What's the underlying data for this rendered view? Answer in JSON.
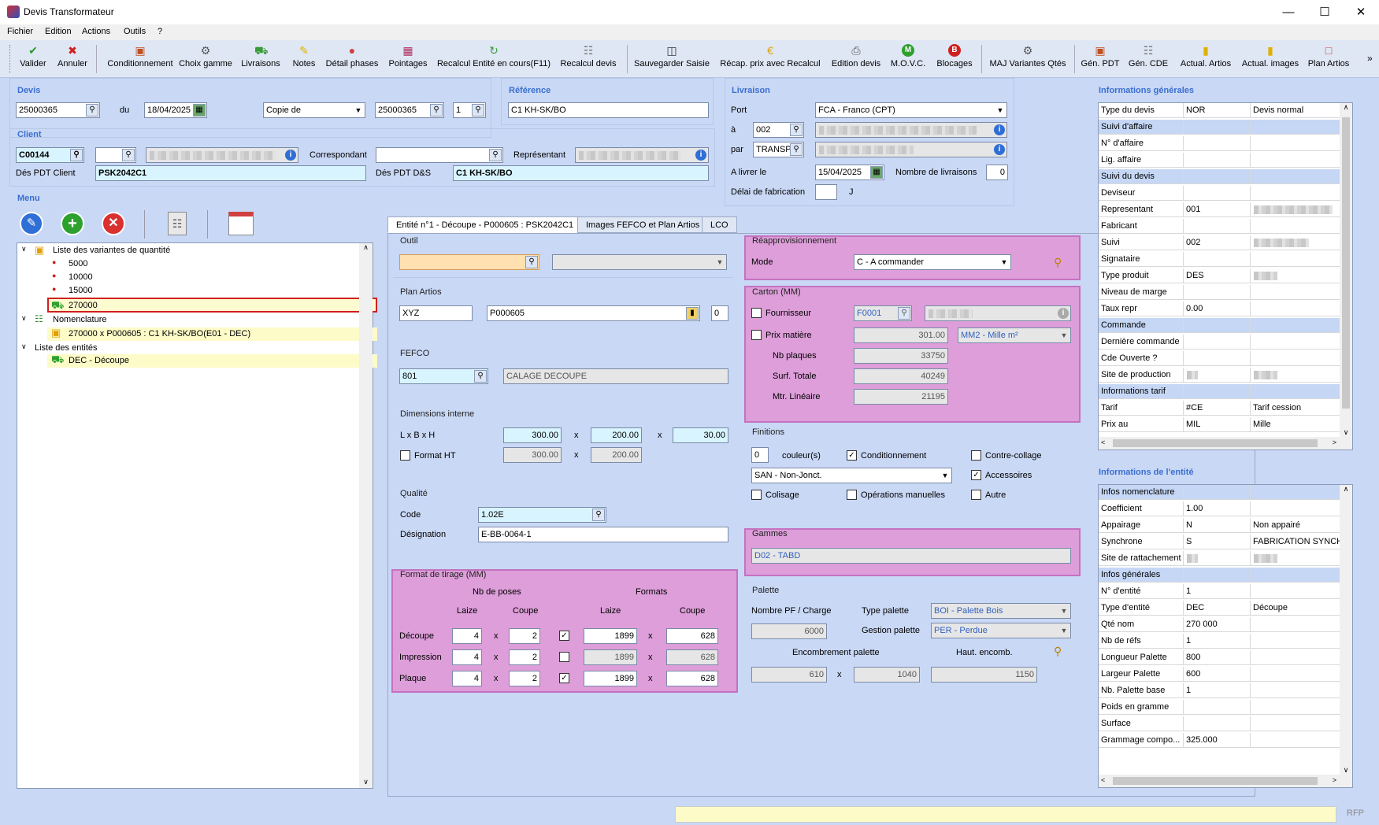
{
  "title": "Devis Transformateur",
  "menu": [
    "Fichier",
    "Edition",
    "Actions",
    "Outils",
    "?"
  ],
  "toolbar": [
    {
      "label": "Valider",
      "icon": "check-icon",
      "color": "#2e9a2e"
    },
    {
      "label": "Annuler",
      "icon": "close-icon",
      "color": "#d02020"
    },
    {
      "label": "Conditionnement",
      "icon": "package-icon",
      "color": "#c05020"
    },
    {
      "label": "Choix gamme",
      "icon": "gears-icon",
      "color": "#555"
    },
    {
      "label": "Livraisons",
      "icon": "truck-icon",
      "color": "#3a9a3a"
    },
    {
      "label": "Notes",
      "icon": "note-icon",
      "color": "#e0b000"
    },
    {
      "label": "Détail phases",
      "icon": "phases-icon",
      "color": "#d04040"
    },
    {
      "label": "Pointages",
      "icon": "grid-icon",
      "color": "#b03060"
    },
    {
      "label": "Recalcul Entité en cours(F11)",
      "icon": "recalc-icon",
      "color": "#3a9a3a"
    },
    {
      "label": "Recalcul devis",
      "icon": "calculator-icon",
      "color": "#777"
    },
    {
      "label": "Sauvegarder Saisie",
      "icon": "save-icon",
      "color": "#333"
    },
    {
      "label": "Récap. prix avec Recalcul",
      "icon": "euro-icon",
      "color": "#e0a000"
    },
    {
      "label": "Edition devis",
      "icon": "printer-icon",
      "color": "#555"
    },
    {
      "label": "M.O.V.C.",
      "icon": "m-icon",
      "color": "#2ea02e"
    },
    {
      "label": "Blocages",
      "icon": "b-icon",
      "color": "#d02020"
    },
    {
      "label": "MAJ Variantes Qtés",
      "icon": "gears-icon",
      "color": "#555"
    },
    {
      "label": "Gén. PDT",
      "icon": "package-icon",
      "color": "#c05020"
    },
    {
      "label": "Gén. CDE",
      "icon": "cart-icon",
      "color": "#777"
    },
    {
      "label": "Actual. Artios",
      "icon": "folder-icon",
      "color": "#e0b000"
    },
    {
      "label": "Actual. images",
      "icon": "folder-icon",
      "color": "#e0b000"
    },
    {
      "label": "Plan Artios",
      "icon": "plan-icon",
      "color": "#d04040"
    }
  ],
  "devis": {
    "title": "Devis",
    "num": "25000365",
    "du": "du",
    "date": "18/04/2025",
    "copie": "Copie de",
    "copie_num": "25000365",
    "copie_idx": "1"
  },
  "reference": {
    "title": "Référence",
    "value": "C1 KH-SK/BO"
  },
  "livraison": {
    "title": "Livraison",
    "port_label": "Port",
    "port": "FCA - Franco (CPT)",
    "a_label": "à",
    "a": "002",
    "par_label": "par",
    "par": "TRANSP",
    "alivrer_label": "A livrer le",
    "alivrer": "15/04/2025",
    "nb_label": "Nombre de livraisons",
    "nb": "0",
    "delai_label": "Délai de fabrication",
    "delai": "",
    "delai_unit": "J"
  },
  "client": {
    "title": "Client",
    "code": "C00144",
    "corr_label": "Correspondant",
    "rep_label": "Représentant",
    "despdt_label": "Dés PDT Client",
    "despdt": "PSK2042C1",
    "despdtds_label": "Dés PDT D&S",
    "despdtds": "C1 KH-SK/BO"
  },
  "menu_section": {
    "title": "Menu"
  },
  "tree": {
    "n1": "Liste des variantes de quantité",
    "q": [
      "5000",
      "10000",
      "15000",
      "270000"
    ],
    "n2": "Nomenclature",
    "n2a": "270000 x P000605 : C1 KH-SK/BO(E01 - DEC)",
    "n3": "Liste des entités",
    "n3a": "DEC - Découpe"
  },
  "tabs": [
    "Entité n°1 - Découpe - P000605 : PSK2042C1",
    "Images FEFCO et Plan Artios",
    "LCO"
  ],
  "outil": {
    "title": "Outil"
  },
  "plan": {
    "title": "Plan Artios",
    "v1": "XYZ",
    "v2": "P000605",
    "v3": "0"
  },
  "fefco": {
    "title": "FEFCO",
    "code": "801",
    "desc": "CALAGE DECOUPE"
  },
  "dim": {
    "title": "Dimensions interne",
    "lbh": "L x B x H",
    "l": "300.00",
    "b": "200.00",
    "h": "30.00",
    "x": "x",
    "fmt_label": "Format HT",
    "fl": "300.00",
    "fb": "200.00"
  },
  "qualite": {
    "title": "Qualité",
    "code_label": "Code",
    "code": "1.02E",
    "des_label": "Désignation",
    "des": "E-BB-0064-1"
  },
  "tirage": {
    "title": "Format de tirage (MM)",
    "nbposes": "Nb de poses",
    "formats": "Formats",
    "laize": "Laize",
    "coupe": "Coupe",
    "rows": [
      {
        "label": "Découpe",
        "a": "4",
        "b": "2",
        "checked": true,
        "c": "1899",
        "d": "628"
      },
      {
        "label": "Impression",
        "a": "4",
        "b": "2",
        "checked": false,
        "c": "1899",
        "d": "628"
      },
      {
        "label": "Plaque",
        "a": "4",
        "b": "2",
        "checked": true,
        "c": "1899",
        "d": "628"
      }
    ]
  },
  "reappro": {
    "title": "Réapprovisionnement",
    "mode_label": "Mode",
    "mode": "C - A commander"
  },
  "carton": {
    "title": "Carton (MM)",
    "fourn_label": "Fournisseur",
    "fourn": "F0001",
    "prix_label": "Prix matière",
    "prix": "301.00",
    "unit": "MM2 - Mille m²",
    "nbp_label": "Nb plaques",
    "nbp": "33750",
    "surf_label": "Surf. Totale",
    "surf": "40249",
    "mtr_label": "Mtr. Linéaire",
    "mtr": "21195"
  },
  "finitions": {
    "title": "Finitions",
    "couleurs": "0",
    "couleurs_label": "couleur(s)",
    "cond_label": "Conditionnement",
    "contre_label": "Contre-collage",
    "san": "SAN - Non-Jonct.",
    "acc_label": "Accessoires",
    "colis_label": "Colisage",
    "ops_label": "Opérations manuelles",
    "autre_label": "Autre"
  },
  "gammes": {
    "title": "Gammes",
    "value": "D02 - TABD"
  },
  "palette": {
    "title": "Palette",
    "nbpf_label": "Nombre PF / Charge",
    "nbpf": "6000",
    "type_label": "Type palette",
    "type": "BOI - Palette Bois",
    "gest_label": "Gestion palette",
    "gest": "PER - Perdue",
    "encomb_label": "Encombrement palette",
    "haut_label": "Haut. encomb.",
    "e1": "610",
    "e2": "1040",
    "haut": "1150"
  },
  "infogen": {
    "title": "Informations générales",
    "rows": [
      [
        "Type du devis",
        "NOR",
        "Devis normal",
        false
      ],
      [
        "Suivi d'affaire",
        "",
        "",
        true
      ],
      [
        "N° d'affaire",
        "",
        "",
        false
      ],
      [
        "Lig. affaire",
        "",
        "",
        false
      ],
      [
        "Suivi du devis",
        "",
        "",
        true
      ],
      [
        "Deviseur",
        "",
        "",
        false
      ],
      [
        "Representant",
        "001",
        "",
        false
      ],
      [
        "Fabricant",
        "",
        "",
        false
      ],
      [
        "Suivi",
        "002",
        "",
        false
      ],
      [
        "Signataire",
        "",
        "",
        false
      ],
      [
        "Type produit",
        "DES",
        "",
        false
      ],
      [
        "Niveau de marge",
        "",
        "",
        false
      ],
      [
        "Taux repr",
        "0.00",
        "",
        false
      ],
      [
        "Commande",
        "",
        "",
        true
      ],
      [
        "Dernière commande",
        "",
        "",
        false
      ],
      [
        "Cde Ouverte ?",
        "",
        "",
        false
      ],
      [
        "Site de production",
        "",
        "",
        false
      ],
      [
        "Informations tarif",
        "",
        "",
        true
      ],
      [
        "Tarif",
        "#CE",
        "Tarif cession",
        false
      ],
      [
        "Prix au",
        "MIL",
        "Mille",
        false
      ]
    ]
  },
  "infoent": {
    "title": "Informations de l'entité",
    "rows": [
      [
        "Infos nomenclature",
        "",
        "",
        true
      ],
      [
        "Coefficient",
        "1.00",
        "",
        false
      ],
      [
        "Appairage",
        "N",
        "Non appairé",
        false
      ],
      [
        "Synchrone",
        "S",
        "FABRICATION SYNCHR",
        false
      ],
      [
        "Site de rattachement",
        "",
        "",
        false
      ],
      [
        "Infos générales",
        "",
        "",
        true
      ],
      [
        "N° d'entité",
        "1",
        "",
        false
      ],
      [
        "Type d'entité",
        "DEC",
        "Découpe",
        false
      ],
      [
        "Qté nom",
        "270 000",
        "",
        false
      ],
      [
        "Nb de réfs",
        "1",
        "",
        false
      ],
      [
        "Longueur Palette",
        "800",
        "",
        false
      ],
      [
        "Largeur Palette",
        "600",
        "",
        false
      ],
      [
        "Nb. Palette base",
        "1",
        "",
        false
      ],
      [
        "Poids en gramme",
        "",
        "",
        false
      ],
      [
        "Surface",
        "",
        "",
        false
      ],
      [
        "Grammage compo...",
        "325.000",
        "",
        false
      ]
    ]
  },
  "status": {
    "right": "RFP"
  }
}
